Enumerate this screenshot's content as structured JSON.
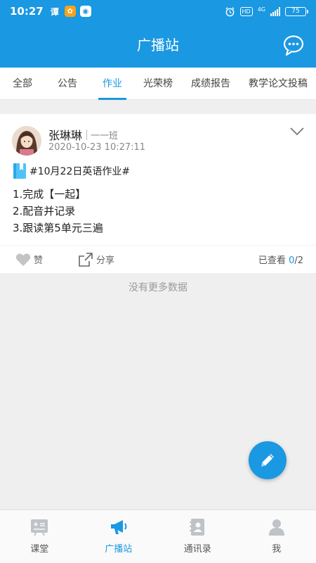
{
  "status_bar": {
    "time": "10:27",
    "app1": "谭",
    "network": "4G",
    "hd": "HD",
    "battery": "75"
  },
  "header": {
    "title": "广播站"
  },
  "tabs": [
    {
      "label": "全部"
    },
    {
      "label": "公告"
    },
    {
      "label": "作业"
    },
    {
      "label": "光荣榜"
    },
    {
      "label": "成绩报告"
    },
    {
      "label": "教学论文投稿"
    }
  ],
  "post": {
    "author": "张琳琳",
    "class": "一一班",
    "timestamp": "2020-10-23 10:27:11",
    "title": "#10月22日英语作业#",
    "lines": [
      "1.完成【一起】",
      "2.配音并记录",
      "3.跟读第5单元三遍"
    ],
    "like_label": "赞",
    "share_label": "分享",
    "viewed_label": "已查看",
    "viewed_count": "0",
    "viewed_total": "/2"
  },
  "list_footer": "没有更多数据",
  "bottom_nav": [
    {
      "label": "课堂"
    },
    {
      "label": "广播站"
    },
    {
      "label": "通讯录"
    },
    {
      "label": "我"
    }
  ],
  "colors": {
    "accent": "#1a98e1",
    "background": "#efefef"
  },
  "active_tab": "作业",
  "active_nav": "广播站"
}
